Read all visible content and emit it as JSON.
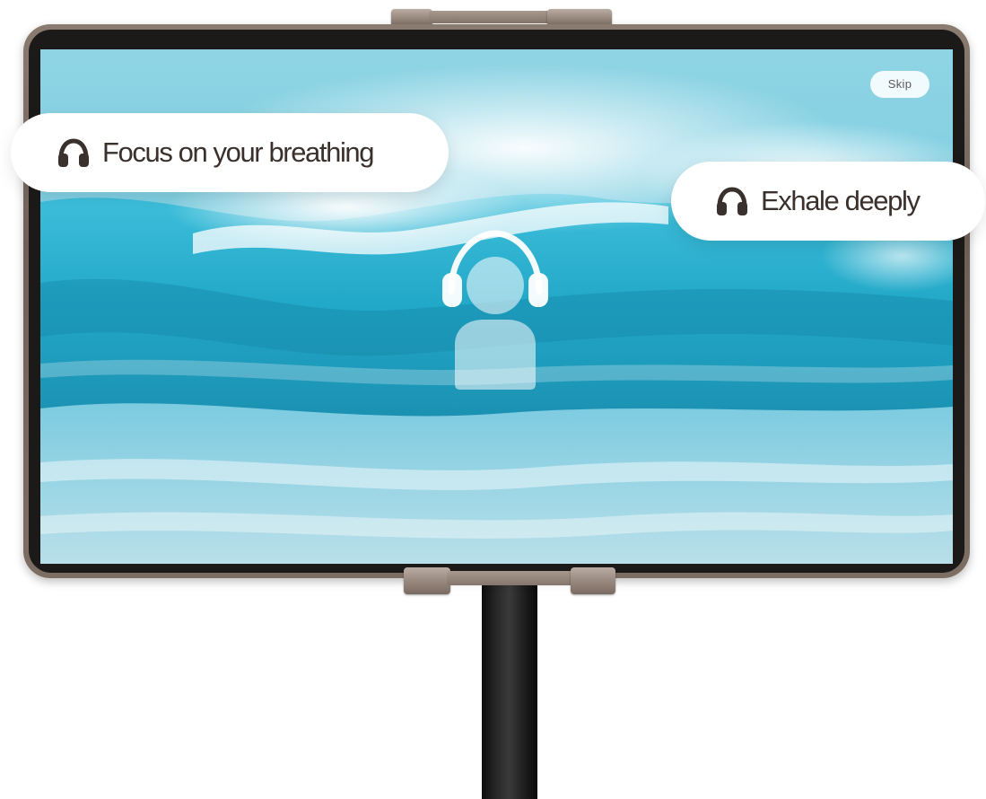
{
  "screen": {
    "skip_label": "Skip",
    "background": "ocean-wave-photo"
  },
  "prompts": [
    {
      "label": "Focus on your breathing",
      "icon": "headphones-icon"
    },
    {
      "label": "Exhale deeply",
      "icon": "headphones-icon"
    }
  ],
  "center_icon": "person-with-headphones-icon",
  "colors": {
    "pill_text": "#3a302c",
    "pill_bg": "#ffffff",
    "frame": "#7d6e64",
    "stand": "#1a1a1a"
  }
}
